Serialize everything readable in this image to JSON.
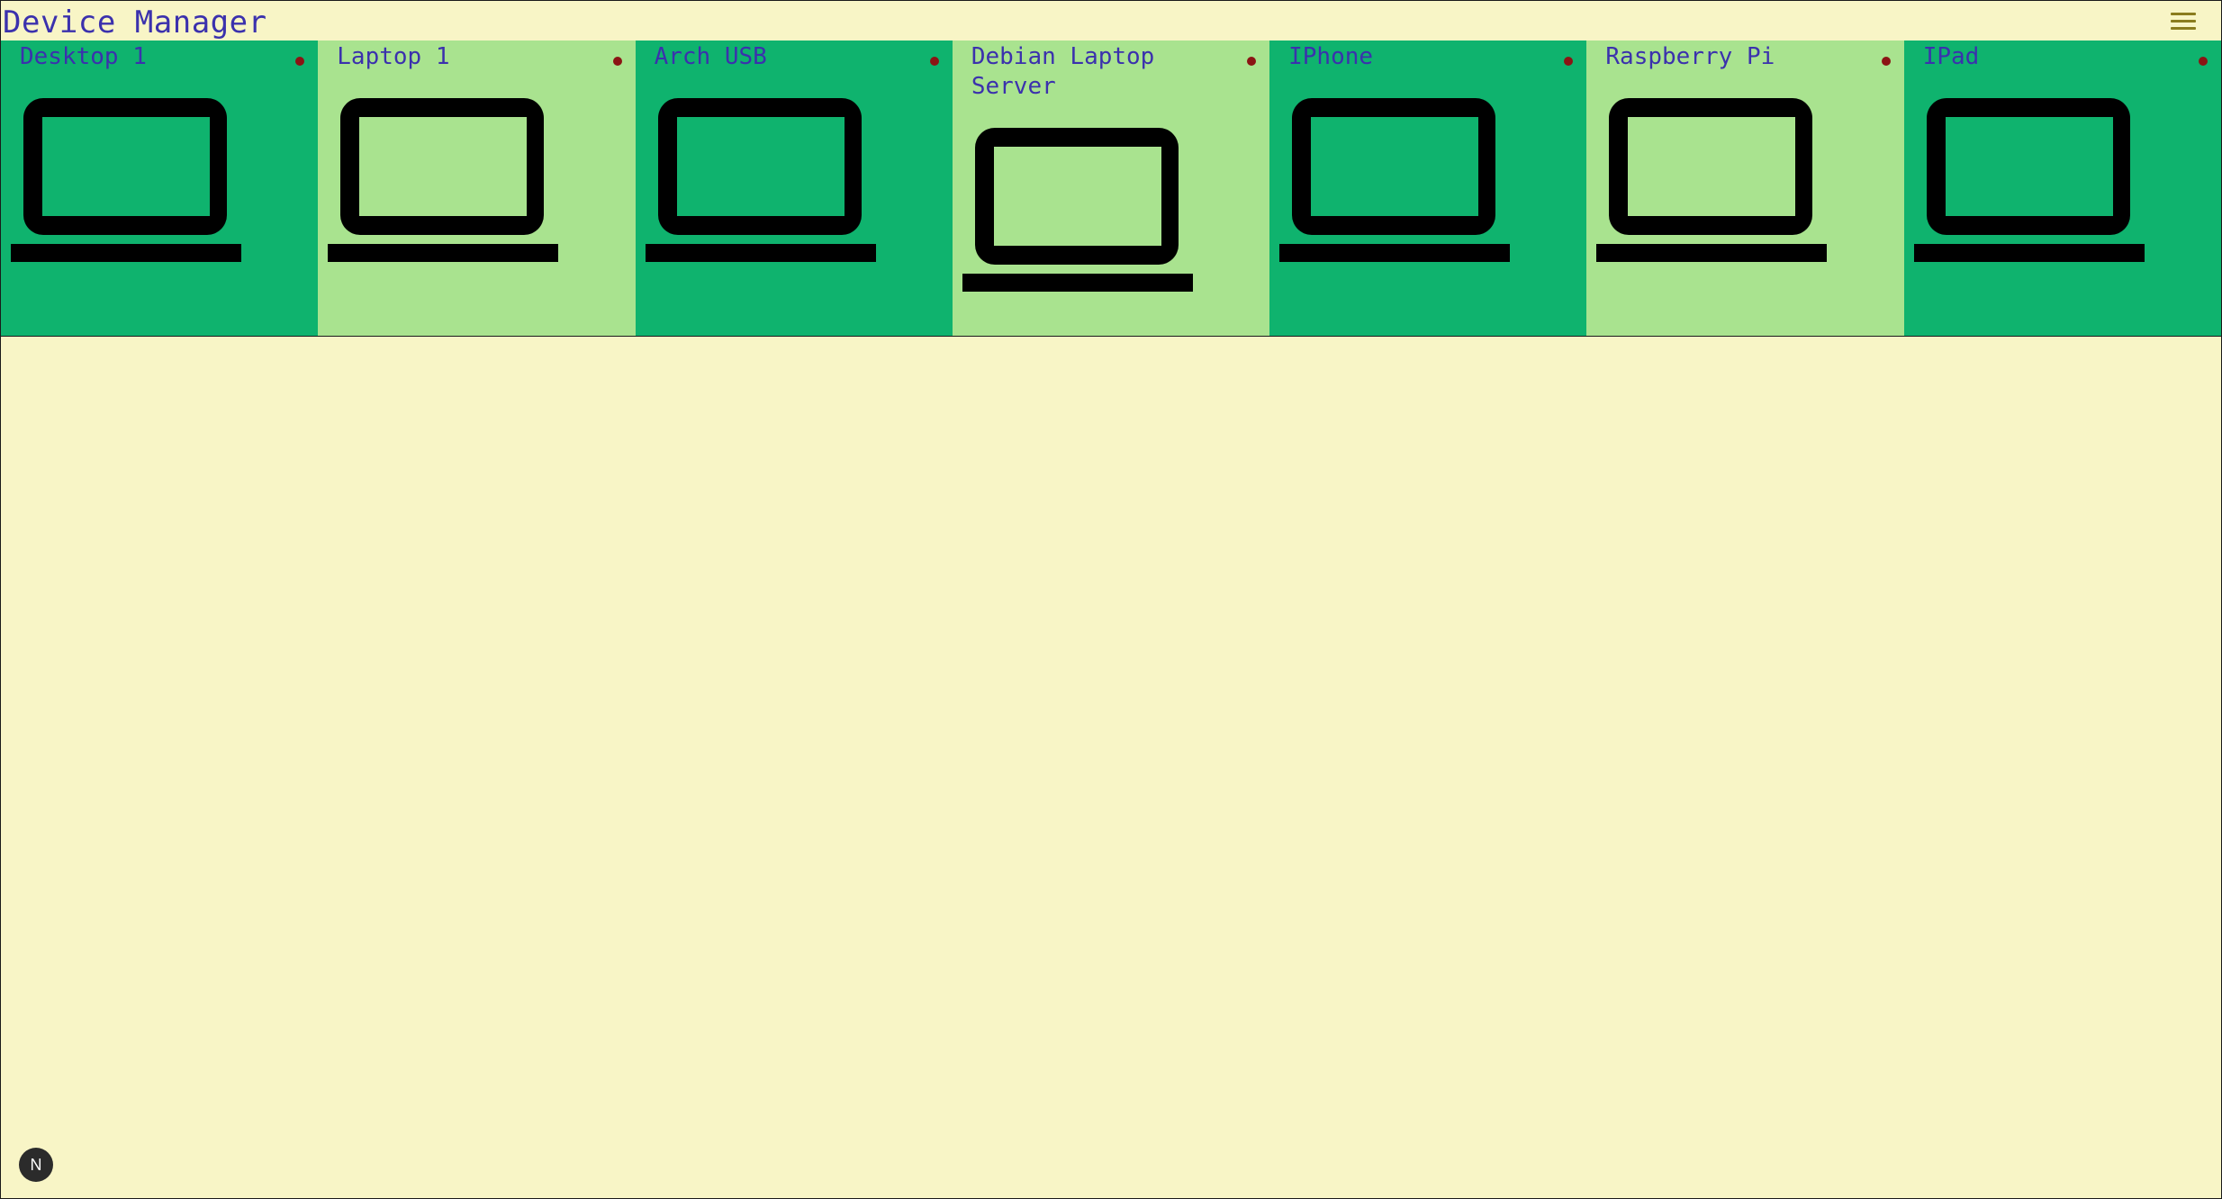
{
  "app": {
    "title": "Device Manager",
    "menu_icon": "hamburger-menu-icon",
    "fab_label": "N"
  },
  "colors": {
    "background": "#f8f5c6",
    "title": "#3b31ad",
    "card_dark": "#0fb36e",
    "card_light": "#a9e38f",
    "status_dot": "#8b1414",
    "icon": "#000000"
  },
  "devices": [
    {
      "name": "Desktop 1",
      "icon": "laptop-icon",
      "status": "offline"
    },
    {
      "name": "Laptop 1",
      "icon": "laptop-icon",
      "status": "offline"
    },
    {
      "name": "Arch USB",
      "icon": "laptop-icon",
      "status": "offline"
    },
    {
      "name": "Debian Laptop Server",
      "icon": "laptop-icon",
      "status": "offline"
    },
    {
      "name": "IPhone",
      "icon": "laptop-icon",
      "status": "offline"
    },
    {
      "name": "Raspberry Pi",
      "icon": "laptop-icon",
      "status": "offline"
    },
    {
      "name": "IPad",
      "icon": "laptop-icon",
      "status": "offline"
    }
  ]
}
